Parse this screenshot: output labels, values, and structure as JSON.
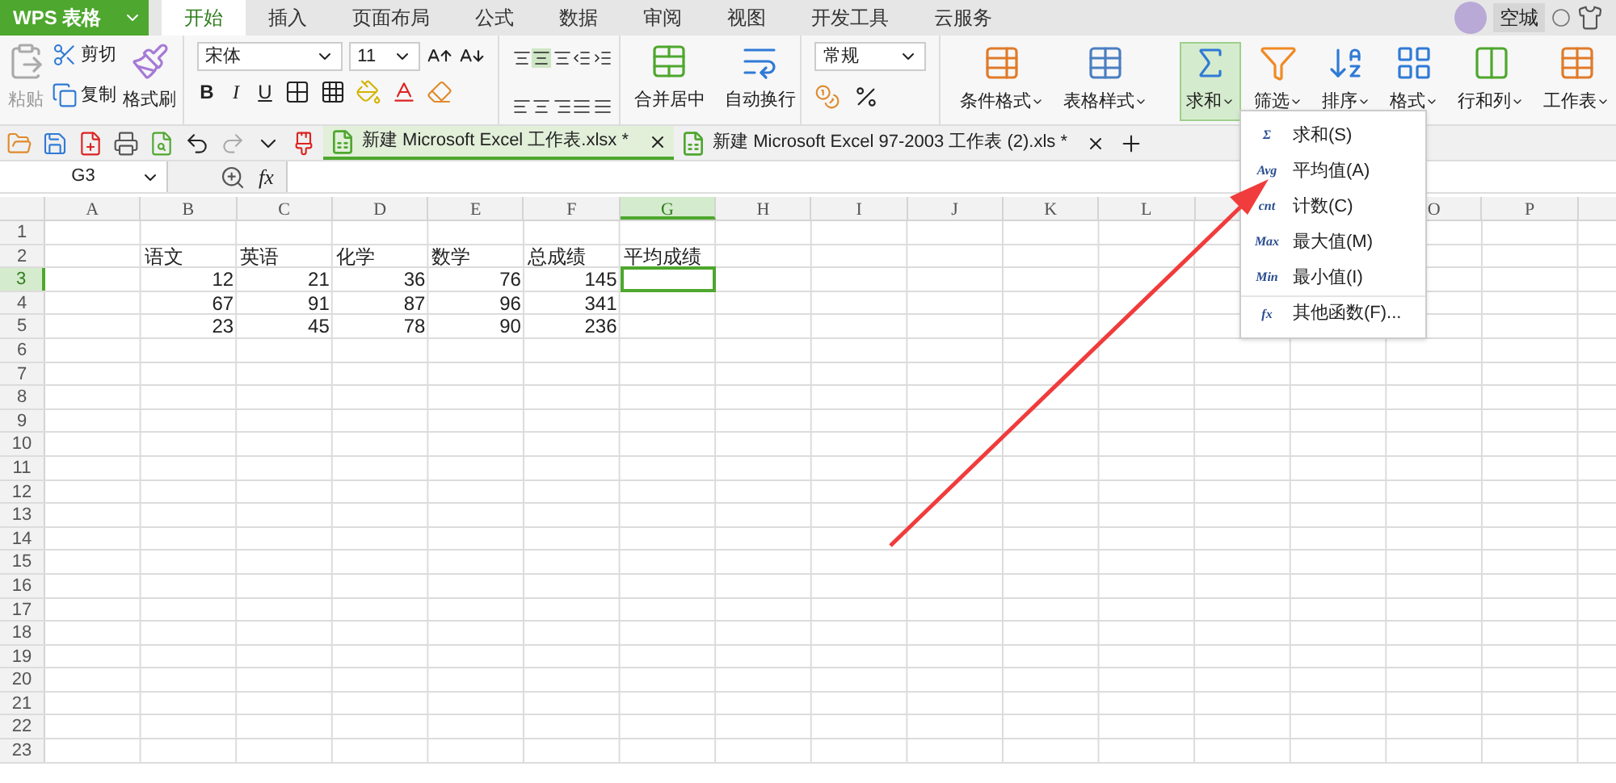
{
  "app_button": {
    "label": "WPS 表格"
  },
  "menu_tabs": [
    {
      "label": "开始",
      "selected": true
    },
    {
      "label": "插入",
      "selected": false
    },
    {
      "label": "页面布局",
      "selected": false
    },
    {
      "label": "公式",
      "selected": false
    },
    {
      "label": "数据",
      "selected": false
    },
    {
      "label": "审阅",
      "selected": false
    },
    {
      "label": "视图",
      "selected": false
    },
    {
      "label": "开发工具",
      "selected": false
    },
    {
      "label": "云服务",
      "selected": false
    }
  ],
  "user": {
    "name": "空城"
  },
  "ribbon": {
    "paste": "粘贴",
    "cut": "剪切",
    "copy": "复制",
    "format_painter": "格式刷",
    "font": "宋体",
    "font_size": "11",
    "style_buttons": [
      "B",
      "I",
      "U"
    ],
    "merge": "合并居中",
    "wrap": "自动换行",
    "number_format": "常规",
    "big_buttons": [
      {
        "label": "条件格式",
        "kind": "condformat",
        "selected": false
      },
      {
        "label": "表格样式",
        "kind": "tablestyle",
        "selected": false
      },
      {
        "label": "求和",
        "kind": "sum",
        "selected": true
      },
      {
        "label": "筛选",
        "kind": "filter",
        "selected": false
      },
      {
        "label": "排序",
        "kind": "sort",
        "selected": false
      },
      {
        "label": "格式",
        "kind": "format",
        "selected": false
      },
      {
        "label": "行和列",
        "kind": "rowcol",
        "selected": false
      },
      {
        "label": "工作表",
        "kind": "sheet",
        "selected": false
      }
    ]
  },
  "doc_tabs": [
    {
      "label": "新建 Microsoft Excel 工作表.xlsx *",
      "selected": true
    },
    {
      "label": "新建 Microsoft Excel 97-2003 工作表 (2).xls *",
      "selected": false
    }
  ],
  "formula_bar": {
    "name_box": "G3",
    "fx": "fx"
  },
  "columns": [
    {
      "label": "A",
      "selected": false
    },
    {
      "label": "B",
      "selected": false
    },
    {
      "label": "C",
      "selected": false
    },
    {
      "label": "D",
      "selected": false
    },
    {
      "label": "E",
      "selected": false
    },
    {
      "label": "F",
      "selected": false
    },
    {
      "label": "G",
      "selected": true
    },
    {
      "label": "H",
      "selected": false
    },
    {
      "label": "I",
      "selected": false
    },
    {
      "label": "J",
      "selected": false
    },
    {
      "label": "K",
      "selected": false
    },
    {
      "label": "L",
      "selected": false
    },
    null,
    null,
    {
      "label": "O",
      "selected": false
    },
    {
      "label": "P",
      "selected": false
    }
  ],
  "rows": [
    {
      "label": "1",
      "selected": false
    },
    {
      "label": "2",
      "selected": false,
      "kind": "text",
      "cells": [
        "语文",
        "英语",
        "化学",
        "数学",
        "总成绩",
        "平均成绩"
      ]
    },
    {
      "label": "3",
      "selected": true,
      "kind": "number",
      "cells": [
        "12",
        "21",
        "36",
        "76",
        "145",
        null
      ]
    },
    {
      "label": "4",
      "selected": false,
      "kind": "number",
      "cells": [
        "67",
        "91",
        "87",
        "96",
        "341",
        null
      ]
    },
    {
      "label": "5",
      "selected": false,
      "kind": "number",
      "cells": [
        "23",
        "45",
        "78",
        "90",
        "236",
        null
      ]
    },
    {
      "label": "6",
      "selected": false
    },
    {
      "label": "7",
      "selected": false
    },
    {
      "label": "8",
      "selected": false
    },
    {
      "label": "9",
      "selected": false
    },
    {
      "label": "10",
      "selected": false
    },
    {
      "label": "11",
      "selected": false
    },
    {
      "label": "12",
      "selected": false
    },
    {
      "label": "13",
      "selected": false
    },
    {
      "label": "14",
      "selected": false
    },
    {
      "label": "15",
      "selected": false
    },
    {
      "label": "16",
      "selected": false
    },
    {
      "label": "17",
      "selected": false
    },
    {
      "label": "18",
      "selected": false
    },
    {
      "label": "19",
      "selected": false
    },
    {
      "label": "20",
      "selected": false
    },
    {
      "label": "21",
      "selected": false
    },
    {
      "label": "22",
      "selected": false
    },
    {
      "label": "23",
      "selected": false
    }
  ],
  "sum_menu": [
    {
      "symbol": "Σ",
      "label": "求和(S)"
    },
    {
      "symbol": "Avg",
      "label": "平均值(A)"
    },
    {
      "symbol": "cnt",
      "label": "计数(C)"
    },
    {
      "symbol": "Max",
      "label": "最大值(M)"
    },
    {
      "symbol": "Min",
      "label": "最小值(I)"
    },
    {
      "symbol": "fx",
      "label": "其他函数(F)..."
    }
  ]
}
